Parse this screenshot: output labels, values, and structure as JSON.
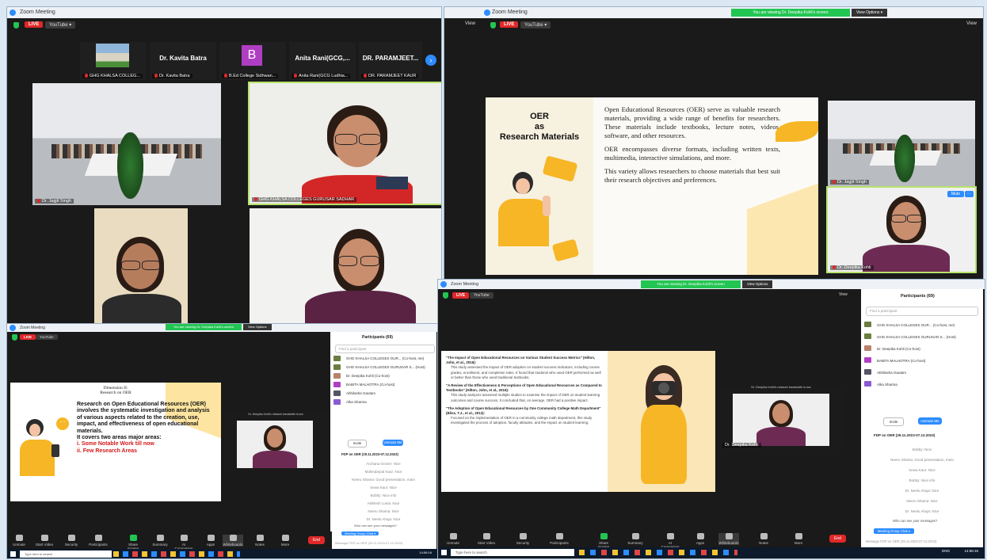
{
  "colors": {
    "live": "#e02828",
    "accent": "#2d8cff",
    "share": "#23c552",
    "slide_red": "#d4191b",
    "slide_orange": "#f6b625"
  },
  "w1": {
    "title": "Zoom Meeting",
    "live": "LIVE",
    "youtube": "YouTube ▾",
    "strip": [
      {
        "name": "",
        "caption": "GHG KHALSA COLLEG..."
      },
      {
        "name": "Dr. Kavita Batra",
        "caption": "Dr. Kavita Batra"
      },
      {
        "name": "B",
        "caption": "B.Ed College Sidhwan..."
      },
      {
        "name": "Anita Rani(GCG,...",
        "caption": "Anita Rani(GCG Ludhia..."
      },
      {
        "name": "DR. PARAMJEET...",
        "caption": "DR. PARAMJEET KAUR"
      }
    ],
    "tiles": {
      "t1": "Dr. Jagjit Singh",
      "t2": "GHG KHALSA COLLEGES GURUSAR SADHAR",
      "t3": "",
      "t4": ""
    }
  },
  "w2": {
    "title": "Zoom Meeting",
    "share_banner": "You are viewing Dr. Deepika Kohli's screen",
    "view_options": "View Options ▾",
    "view": "View",
    "live": "LIVE",
    "youtube": "YouTube ▾",
    "slide": {
      "heading_l1": "OER",
      "heading_l2": "as",
      "heading_l3": "Research Materials",
      "p1": "Open Educational Resources (OER) serve as valuable research materials, providing a wide range of benefits for researchers. These materials include textbooks, lecture notes, videos, software, and other resources.",
      "p2": "OER encompasses diverse formats, including written texts, multimedia, interactive simulations, and more.",
      "p3": "This variety allows researchers to choose materials that best suit their research objectives and preferences."
    },
    "side_tiles": {
      "t1": "Dr. Jagjit Singh",
      "t2": "Dr. Deepika Kohli"
    },
    "mute_label": "Mute"
  },
  "w3": {
    "title": "Zoom Meeting",
    "share_banner": "You are viewing Dr. Deepika Kohli's screen",
    "view_options": "View Options",
    "live": "LIVE",
    "youtube": "YouTube",
    "slide": {
      "t1": "Dimension II:",
      "t2": "Research on OER",
      "body": "Research on Open Educational Resources (OER) involves the systematic investigation and analysis of various aspects related to the creation, use, impact, and effectiveness of open educational materials.",
      "areas": "It covers two areas major areas:",
      "i": "i. Some Notable Work till now",
      "ii": "ii. Few Research Areas"
    },
    "thumb_label": "Dr. Deepika Kohli's network bandwidth is low",
    "participants_title": "Participants (69)",
    "find": "Find a participant",
    "participants": [
      "GHG KHALSA COLLEGES GUR... (Co-host, me)",
      "GHG KHALSA COLLEGES GURUSAR S... (Host)",
      "Dr. Deepika Kohli (Co-host)",
      "BABITA MALHOTRA (Co-host)",
      "Abhilasha Gautam",
      "Alka Sharma"
    ],
    "invite": "Invite",
    "unmute_me": "Unmute Me",
    "chat_title": "FDP on OER (29.11.2023-07.12.2023)",
    "chat_msgs": [
      "Archana Grover: Nice",
      "Mahindarpal Kaur: Nice",
      "Neeru Shama: Good presentation, mam",
      "Sewa Kaur: Nice",
      "Bobby: Nice info",
      "Akhilesh Lunia: Nice",
      "Neeru Shama: Nice",
      "Dr. Neelu Ahuja: Nice"
    ],
    "who_can_see": "Who can see your messages?",
    "meeting_chat": "Meeting Group Chat ▾",
    "message_ph": "Message FDP on OER (29.11.2023-07.12.2023)"
  },
  "w4": {
    "title": "Zoom Meeting",
    "share_banner": "You are viewing Dr. Deepika Kohli's screen",
    "view_options": "View Options",
    "live": "LIVE",
    "youtube": "YouTube",
    "view": "View",
    "slide": {
      "b1": "\"The Impact of Open Educational Resources on Various Student Success Metrics\" (Hilton, John, et al., 2016):",
      "b1d": "This study assessed the impact of OER adoption on student success indicators, including course grades, enrollment, and completion rates. It found that students who used OER performed as well or better than those who used traditional textbooks.",
      "b2": "\"A Review of the Effectiveness & Perceptions of Open Educational Resources as Compared to Textbooks\" (Hilton, John, et al., 2016):",
      "b2d": "This study analyzes assessed multiple studies to examine the impact of OER on student learning outcomes and course success. It concluded that, on average, OER had a positive impact.",
      "b3": "\"The Adoption of Open Educational Resources by One Community College Math Department\" (Bliss, T.J., et al., 2013):",
      "b3d": "Focused on the implementation of OER in a community college math department, this study investigated the process of adoption, faculty attitudes, and the impact on student learning."
    },
    "thumb_label": "Dr. Deepika Kohli's network bandwidth is low",
    "thumb_name": "Dr. Deepika Kohli",
    "participants_title": "Participants (69)",
    "find": "Find a participant",
    "participants": [
      "GHG KHALSA COLLEGES GUR... (Co-host, me)",
      "GHG KHALSA COLLEGES GURUSAR S... (Host)",
      "Dr. Deepika Kohli (Co-host)",
      "BABITA MALHOTRA (Co-host)",
      "Abhilasha Gautam",
      "Alka Sharma"
    ],
    "invite": "Invite",
    "unmute_me": "Unmute Me",
    "chat_title": "FDP on OER (29.11.2023-07.12.2023)",
    "chat_msgs": [
      "Bobby: Nice",
      "Neeru Shama: Good presentation, mam",
      "Sewa Kaur: Nice",
      "Bobby: Nice info",
      "Dr. Neelu Ahuja: Nice",
      "Neeru Shama: Nice",
      "Dr. Neelu Ahuja: Nice"
    ],
    "who_can_see": "Who can see your messages?",
    "meeting_chat": "Meeting Group Chat ▾",
    "message_ph": "Message FDP on OER (29.11.2023-07.12.2023)",
    "end": "End"
  },
  "toolbar": [
    "Unmute",
    "Start Video",
    "Security",
    "Participants",
    "Share Screen",
    "Summary",
    "AI Companion",
    "Apps",
    "Whiteboards",
    "Notes",
    "More"
  ],
  "taskbar": {
    "search": "Type here to search",
    "time": "14:56:16",
    "lang": "ENG"
  }
}
